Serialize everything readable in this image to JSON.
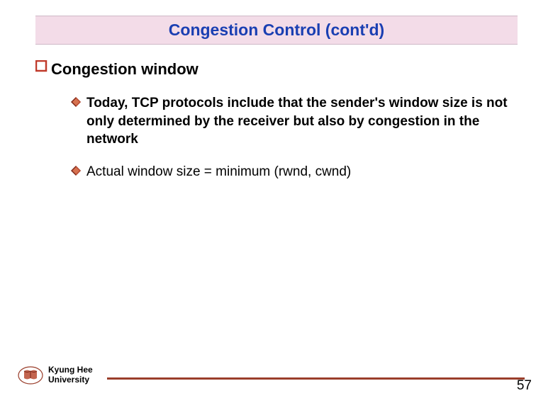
{
  "title": "Congestion Control (cont'd)",
  "section": {
    "heading": "Congestion window",
    "bullets": [
      "Today, TCP protocols include that the sender's window size is not only determined by the receiver but also by congestion in the network",
      "Actual window size = minimum (rwnd, cwnd)"
    ]
  },
  "footer": {
    "institution_line1": "Kyung Hee",
    "institution_line2": "University",
    "page_number": "57"
  }
}
